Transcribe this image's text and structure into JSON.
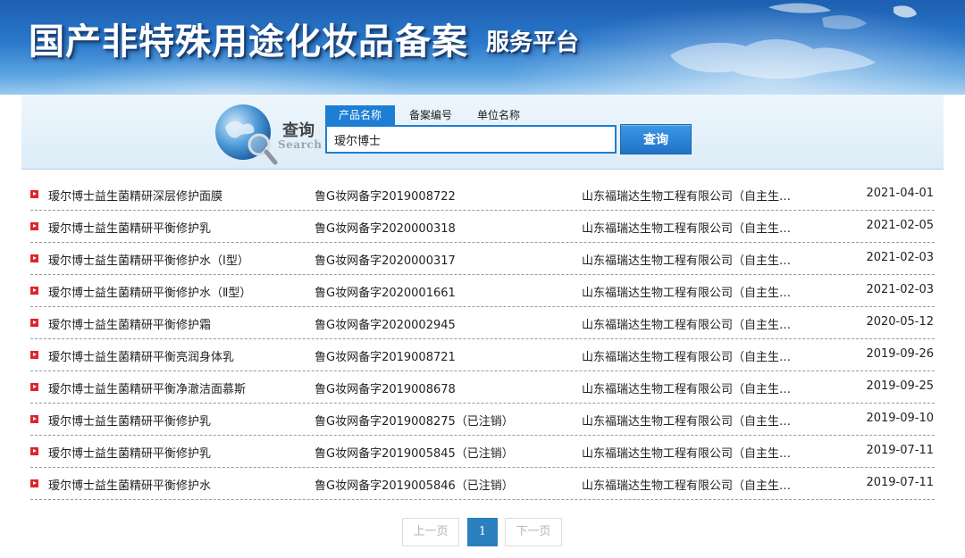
{
  "header": {
    "title": "国产非特殊用途化妆品备案",
    "subtitle": "服务平台"
  },
  "search": {
    "label_cn": "查询",
    "label_en": "Search",
    "tabs": [
      {
        "label": "产品名称",
        "active": true
      },
      {
        "label": "备案编号",
        "active": false
      },
      {
        "label": "单位名称",
        "active": false
      }
    ],
    "query": "瑷尔博士",
    "button_label": "查询"
  },
  "colors": {
    "accent": "#1e7ed4",
    "bullet": "#e0242c",
    "current_page": "#2a7fbf"
  },
  "results": [
    {
      "name": "瑷尔博士益生菌精研深层修护面膜",
      "reg_no": "鲁G妆网备字2019008722",
      "company": "山东福瑞达生物工程有限公司（自主生…",
      "date": "2021-04-01"
    },
    {
      "name": "瑷尔博士益生菌精研平衡修护乳",
      "reg_no": "鲁G妆网备字2020000318",
      "company": "山东福瑞达生物工程有限公司（自主生…",
      "date": "2021-02-05"
    },
    {
      "name": "瑷尔博士益生菌精研平衡修护水（I型）",
      "reg_no": "鲁G妆网备字2020000317",
      "company": "山东福瑞达生物工程有限公司（自主生…",
      "date": "2021-02-03"
    },
    {
      "name": "瑷尔博士益生菌精研平衡修护水（Ⅱ型）",
      "reg_no": "鲁G妆网备字2020001661",
      "company": "山东福瑞达生物工程有限公司（自主生…",
      "date": "2021-02-03"
    },
    {
      "name": "瑷尔博士益生菌精研平衡修护霜",
      "reg_no": "鲁G妆网备字2020002945",
      "company": "山东福瑞达生物工程有限公司（自主生…",
      "date": "2020-05-12"
    },
    {
      "name": "瑷尔博士益生菌精研平衡亮润身体乳",
      "reg_no": "鲁G妆网备字2019008721",
      "company": "山东福瑞达生物工程有限公司（自主生…",
      "date": "2019-09-26"
    },
    {
      "name": "瑷尔博士益生菌精研平衡净澈洁面慕斯",
      "reg_no": "鲁G妆网备字2019008678",
      "company": "山东福瑞达生物工程有限公司（自主生…",
      "date": "2019-09-25"
    },
    {
      "name": "瑷尔博士益生菌精研平衡修护乳",
      "reg_no": "鲁G妆网备字2019008275（已注销）",
      "company": "山东福瑞达生物工程有限公司（自主生…",
      "date": "2019-09-10"
    },
    {
      "name": "瑷尔博士益生菌精研平衡修护乳",
      "reg_no": "鲁G妆网备字2019005845（已注销）",
      "company": "山东福瑞达生物工程有限公司（自主生…",
      "date": "2019-07-11"
    },
    {
      "name": "瑷尔博士益生菌精研平衡修护水",
      "reg_no": "鲁G妆网备字2019005846（已注销）",
      "company": "山东福瑞达生物工程有限公司（自主生…",
      "date": "2019-07-11"
    }
  ],
  "pagination": {
    "prev_label": "上一页",
    "current": "1",
    "next_label": "下一页"
  }
}
